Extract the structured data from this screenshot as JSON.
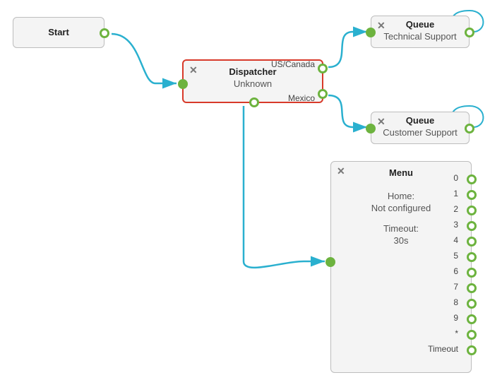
{
  "nodes": {
    "start": {
      "title": "Start"
    },
    "dispatcher": {
      "title": "Dispatcher",
      "subtitle": "Unknown",
      "out_top": "US/Canada",
      "out_right": "Mexico"
    },
    "queue1": {
      "title": "Queue",
      "subtitle": "Technical Support"
    },
    "queue2": {
      "title": "Queue",
      "subtitle": "Customer Support"
    },
    "menu": {
      "title": "Menu",
      "home_label": "Home:",
      "home_value": "Not configured",
      "timeout_label": "Timeout:",
      "timeout_value": "30s",
      "outs": [
        "0",
        "1",
        "2",
        "3",
        "4",
        "5",
        "6",
        "7",
        "8",
        "9",
        "*",
        "Timeout"
      ]
    }
  },
  "colors": {
    "port": "#6db33f",
    "wire": "#2ab0cf",
    "arrow": "#2ab0cf",
    "selected": "#d83a2a"
  }
}
